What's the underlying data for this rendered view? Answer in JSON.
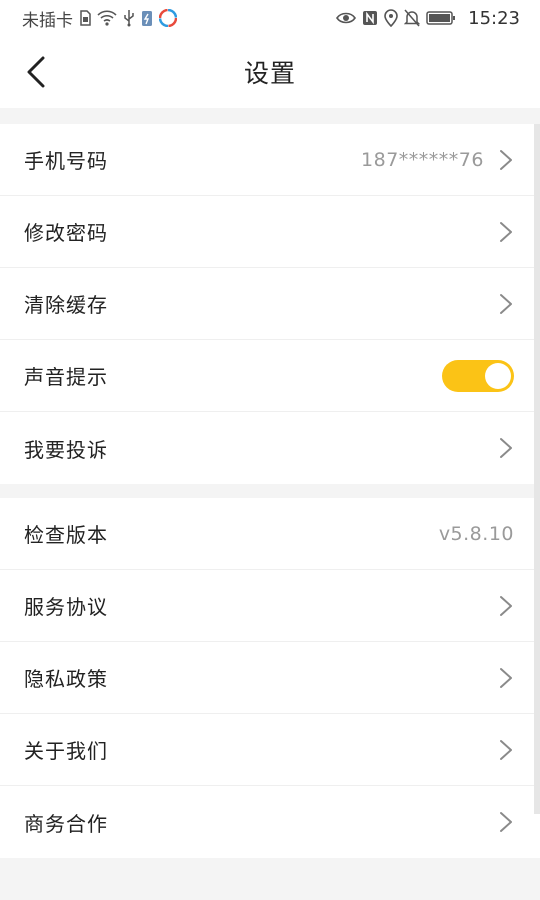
{
  "status_bar": {
    "left_text": "未插卡",
    "icons_left": [
      "sim-icon",
      "wifi-icon",
      "usb-icon",
      "battery-charge-icon",
      "app-icon"
    ],
    "icons_right": [
      "eye-icon",
      "nfc-icon",
      "location-icon",
      "mute-icon",
      "battery-icon"
    ],
    "time": "15:23"
  },
  "header": {
    "title": "设置"
  },
  "group1": {
    "phone": {
      "label": "手机号码",
      "value": "187******76"
    },
    "change_password": {
      "label": "修改密码"
    },
    "clear_cache": {
      "label": "清除缓存"
    },
    "sound": {
      "label": "声音提示",
      "on": true
    },
    "complaint": {
      "label": "我要投诉"
    }
  },
  "group2": {
    "version": {
      "label": "检查版本",
      "value": "v5.8.10"
    },
    "service": {
      "label": "服务协议"
    },
    "privacy": {
      "label": "隐私政策"
    },
    "about": {
      "label": "关于我们"
    },
    "business": {
      "label": "商务合作"
    }
  },
  "colors": {
    "accent": "#fbc316",
    "background": "#f4f4f4"
  }
}
